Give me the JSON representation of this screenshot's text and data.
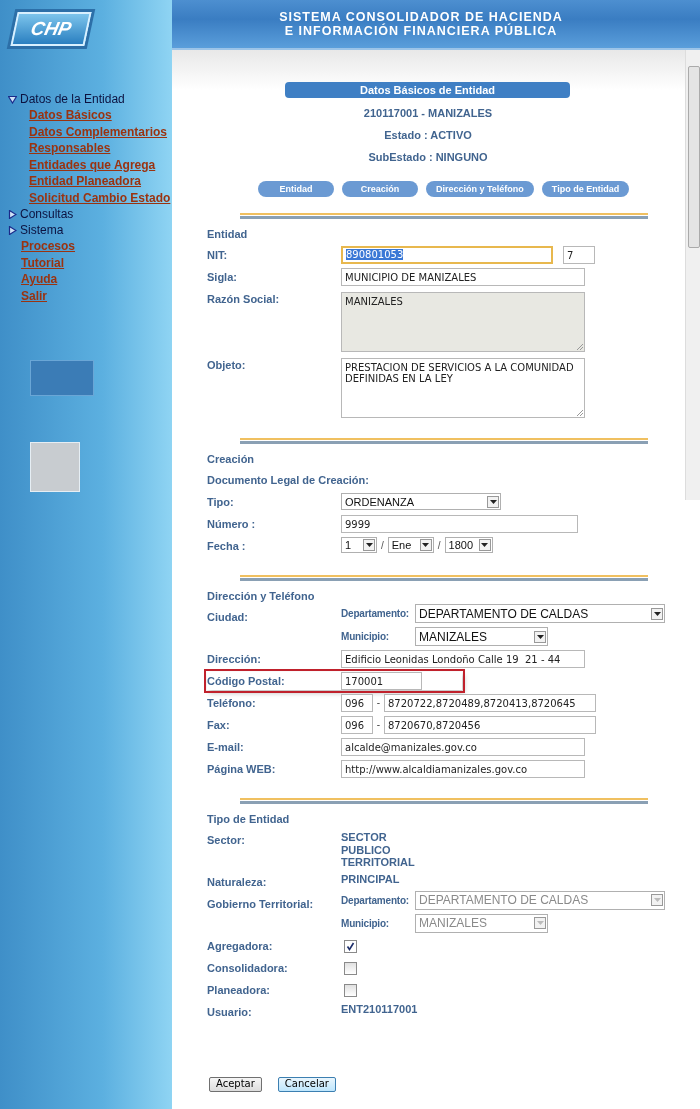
{
  "header": {
    "logo_text": "CHP",
    "title_lines": [
      "SISTEMA CONSOLIDADOR DE HACIENDA",
      "E INFORMACIÓN FINANCIERA PÚBLICA"
    ]
  },
  "sidebar": {
    "items": [
      {
        "kind": "group",
        "label": "Datos de la Entidad",
        "expanded": true,
        "children": [
          {
            "label": "Datos Básicos"
          },
          {
            "label": "Datos Complementarios"
          },
          {
            "label": "Responsables"
          },
          {
            "label": "Entidades que Agrega"
          },
          {
            "label": "Entidad Planeadora"
          },
          {
            "label": "Solicitud Cambio Estado"
          }
        ]
      },
      {
        "kind": "group",
        "label": "Consultas",
        "expanded": false
      },
      {
        "kind": "group",
        "label": "Sistema",
        "expanded": false
      },
      {
        "kind": "link",
        "label": "Procesos"
      },
      {
        "kind": "link",
        "label": "Tutorial"
      },
      {
        "kind": "link",
        "label": "Ayuda"
      },
      {
        "kind": "link",
        "label": "Salir"
      }
    ]
  },
  "page": {
    "title": "Datos Básicos de Entidad",
    "info_lines": [
      "210117001 - MANIZALES",
      "Estado : ACTIVO",
      "SubEstado : NINGUNO"
    ],
    "section_buttons": [
      "Entidad",
      "Creación",
      "Dirección y Teléfono",
      "Tipo de Entidad"
    ]
  },
  "sections": [
    {
      "title": "Entidad",
      "rows": [
        {
          "kind": "nit",
          "label": "NIT:",
          "value": "890801053",
          "check_digit": "7",
          "focused": true
        },
        {
          "kind": "input",
          "label": "Sigla:",
          "value": "MUNICIPIO DE MANIZALES"
        },
        {
          "kind": "textarea",
          "label": "Razón Social:",
          "value": "MANIZALES",
          "disabled": true
        },
        {
          "kind": "textarea",
          "label": "Objeto:",
          "value": "PRESTACION DE SERVICIOS A LA COMUNIDAD DEFINIDAS EN LA LEY",
          "disabled": false
        }
      ]
    },
    {
      "title": "Creación",
      "rows": [
        {
          "kind": "subtitle",
          "label": "Documento Legal de Creación:"
        },
        {
          "kind": "select",
          "label": "Tipo:",
          "value": "ORDENANZA"
        },
        {
          "kind": "input",
          "label": "Número :",
          "value": "9999"
        },
        {
          "kind": "date",
          "label": "Fecha :",
          "parts": [
            "1",
            "Ene",
            "1800"
          ],
          "separators": [
            "/",
            "/"
          ]
        }
      ]
    },
    {
      "title": "Dirección y Teléfono",
      "rows": [
        {
          "kind": "location",
          "label": "Ciudad:",
          "disabled": false,
          "fields": [
            {
              "label": "Departamento:",
              "value": "DEPARTAMENTO DE CALDAS"
            },
            {
              "label": "Municipio:",
              "value": "MANIZALES"
            }
          ]
        },
        {
          "kind": "input",
          "label": "Dirección:",
          "value": "Edificio Leonidas Londoño Calle 19  21 - 44",
          "highlighted": false
        },
        {
          "kind": "input",
          "label": "Código Postal:",
          "value": "170001",
          "highlighted": true
        },
        {
          "kind": "phone",
          "label": "Teléfono:",
          "area": "096",
          "separator": "-",
          "number": "8720722,8720489,8720413,8720645"
        },
        {
          "kind": "phone",
          "label": "Fax:",
          "area": "096",
          "separator": "-",
          "number": "8720670,8720456"
        },
        {
          "kind": "input",
          "label": "E-mail:",
          "value": "alcalde@manizales.gov.co",
          "highlighted": false
        },
        {
          "kind": "input",
          "label": "Página WEB:",
          "value": "http://www.alcaldiamanizales.gov.co",
          "highlighted": false
        }
      ]
    },
    {
      "title": "Tipo de Entidad",
      "rows": [
        {
          "kind": "text",
          "label": "Sector:",
          "value": "SECTOR PUBLICO TERRITORIAL"
        },
        {
          "kind": "text",
          "label": "Naturaleza:",
          "value": "PRINCIPAL"
        },
        {
          "kind": "location",
          "label": "Gobierno Territorial:",
          "disabled": true,
          "fields": [
            {
              "label": "Departamento:",
              "value": "DEPARTAMENTO DE CALDAS"
            },
            {
              "label": "Municipio:",
              "value": "MANIZALES"
            }
          ]
        },
        {
          "kind": "checkbox",
          "label": "Agregadora:",
          "checked": true
        },
        {
          "kind": "checkbox",
          "label": "Consolidadora:",
          "checked": false
        },
        {
          "kind": "checkbox",
          "label": "Planeadora:",
          "checked": false
        },
        {
          "kind": "text",
          "label": "Usuario:",
          "value": "ENT210117001"
        }
      ]
    }
  ],
  "buttons": [
    {
      "label": "Aceptar",
      "focused": false
    },
    {
      "label": "Cancelar",
      "focused": true
    }
  ]
}
